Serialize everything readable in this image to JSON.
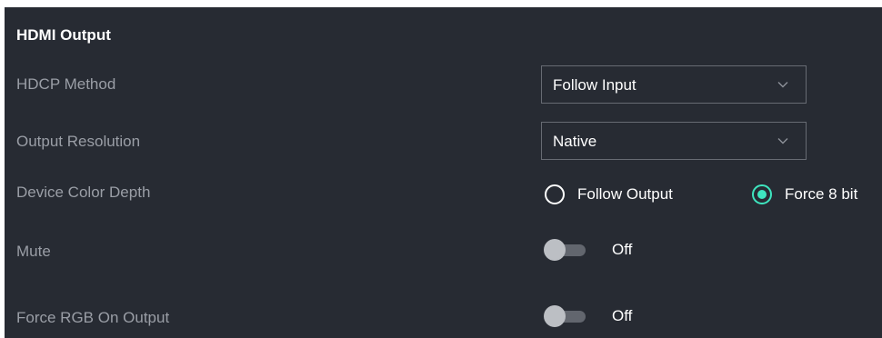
{
  "panel": {
    "title": "HDMI Output"
  },
  "hdcp": {
    "label": "HDCP Method",
    "value": "Follow Input"
  },
  "resolution": {
    "label": "Output Resolution",
    "value": "Native"
  },
  "color_depth": {
    "label": "Device Color Depth",
    "options": [
      {
        "label": "Follow Output",
        "selected": false
      },
      {
        "label": "Force 8 bit",
        "selected": true
      }
    ]
  },
  "mute": {
    "label": "Mute",
    "state": "Off"
  },
  "force_rgb": {
    "label": "Force RGB On Output",
    "state": "Off"
  },
  "colors": {
    "panel_bg": "#272b33",
    "accent": "#3ee5bf",
    "label_text": "#9a9ea6",
    "value_text": "#ffffff"
  },
  "icons": {
    "dropdown": "chevron-down-icon"
  }
}
